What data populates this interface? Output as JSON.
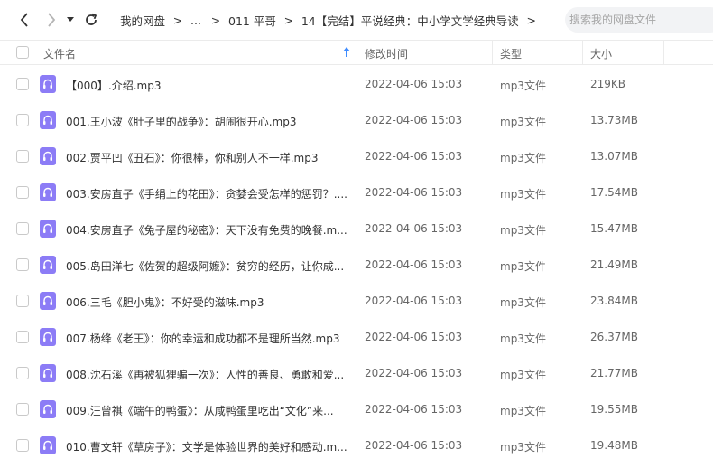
{
  "toolbar": {
    "back_icon": "chevron-left-icon",
    "forward_icon": "chevron-right-icon",
    "history_icon": "caret-down-icon",
    "refresh_icon": "refresh-icon"
  },
  "breadcrumb": {
    "items": [
      "我的网盘",
      "...",
      "011 平哥",
      "14【完结】平说经典：中小学文学经典导读"
    ],
    "separator": ">"
  },
  "search": {
    "placeholder": "搜索我的网盘文件"
  },
  "columns": {
    "name": "文件名",
    "mtime": "修改时间",
    "type": "类型",
    "size": "大小"
  },
  "colors": {
    "accent": "#3f8cff",
    "file_icon": "#8c7cf6"
  },
  "files": [
    {
      "name": "【000】.介绍.mp3",
      "mtime": "2022-04-06 15:03",
      "type": "mp3文件",
      "size": "219KB"
    },
    {
      "name": "001.王小波《肚子里的战争》：胡闹很开心.mp3",
      "mtime": "2022-04-06 15:03",
      "type": "mp3文件",
      "size": "13.73MB"
    },
    {
      "name": "002.贾平凹《丑石》：你很棒，你和别人不一样.mp3",
      "mtime": "2022-04-06 15:03",
      "type": "mp3文件",
      "size": "13.07MB"
    },
    {
      "name": "003.安房直子《手绢上的花田》：贪婪会受怎样的惩罚？....",
      "mtime": "2022-04-06 15:03",
      "type": "mp3文件",
      "size": "17.54MB"
    },
    {
      "name": "004.安房直子《兔子屋的秘密》：天下没有免费的晚餐.m...",
      "mtime": "2022-04-06 15:03",
      "type": "mp3文件",
      "size": "15.47MB"
    },
    {
      "name": "005.岛田洋七《佐贺的超级阿嬷》：贫穷的经历，让你成...",
      "mtime": "2022-04-06 15:03",
      "type": "mp3文件",
      "size": "21.49MB"
    },
    {
      "name": "006.三毛《胆小鬼》：不好受的滋味.mp3",
      "mtime": "2022-04-06 15:03",
      "type": "mp3文件",
      "size": "23.84MB"
    },
    {
      "name": "007.杨绛《老王》：你的幸运和成功都不是理所当然.mp3",
      "mtime": "2022-04-06 15:03",
      "type": "mp3文件",
      "size": "26.37MB"
    },
    {
      "name": "008.沈石溪《再被狐狸骗一次》：人性的善良、勇敢和爱...",
      "mtime": "2022-04-06 15:03",
      "type": "mp3文件",
      "size": "21.77MB"
    },
    {
      "name": "009.汪曾祺《端午的鸭蛋》：从咸鸭蛋里吃出“文化”来...",
      "mtime": "2022-04-06 15:03",
      "type": "mp3文件",
      "size": "19.55MB"
    },
    {
      "name": "010.曹文轩《草房子》：文学是体验世界的美好和感动.m...",
      "mtime": "2022-04-06 15:03",
      "type": "mp3文件",
      "size": "19.48MB"
    }
  ]
}
